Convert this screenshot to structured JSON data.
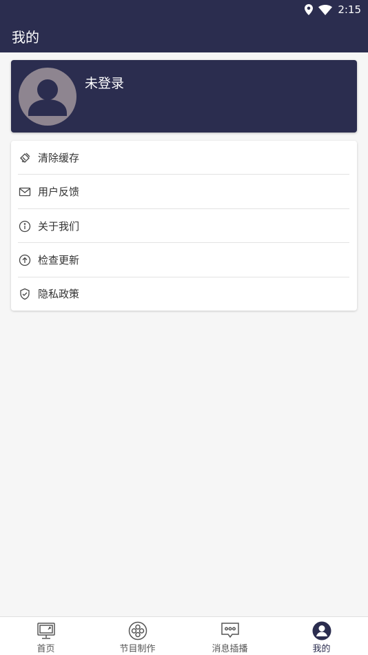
{
  "status_bar": {
    "time": "2:15",
    "icons": [
      "location-icon",
      "wifi-icon",
      "battery-icon"
    ]
  },
  "app_bar": {
    "title": "我的"
  },
  "profile": {
    "name": "未登录",
    "avatar_icon": "default-user-avatar-icon"
  },
  "menu": {
    "items": [
      {
        "label": "清除缓存",
        "icon": "broom-icon"
      },
      {
        "label": "用户反馈",
        "icon": "mail-icon"
      },
      {
        "label": "关于我们",
        "icon": "info-icon"
      },
      {
        "label": "检查更新",
        "icon": "upload-arrow-icon"
      },
      {
        "label": "隐私政策",
        "icon": "shield-check-icon"
      }
    ]
  },
  "bottom_nav": {
    "items": [
      {
        "label": "首页",
        "icon": "monitor-icon"
      },
      {
        "label": "节目制作",
        "icon": "film-reel-icon"
      },
      {
        "label": "消息插播",
        "icon": "message-icon"
      },
      {
        "label": "我的",
        "icon": "user-circle-icon"
      }
    ],
    "active_index": 3
  },
  "colors": {
    "primary": "#2b2d4f",
    "background": "#f6f6f6",
    "avatar_bg": "#8e8590"
  }
}
